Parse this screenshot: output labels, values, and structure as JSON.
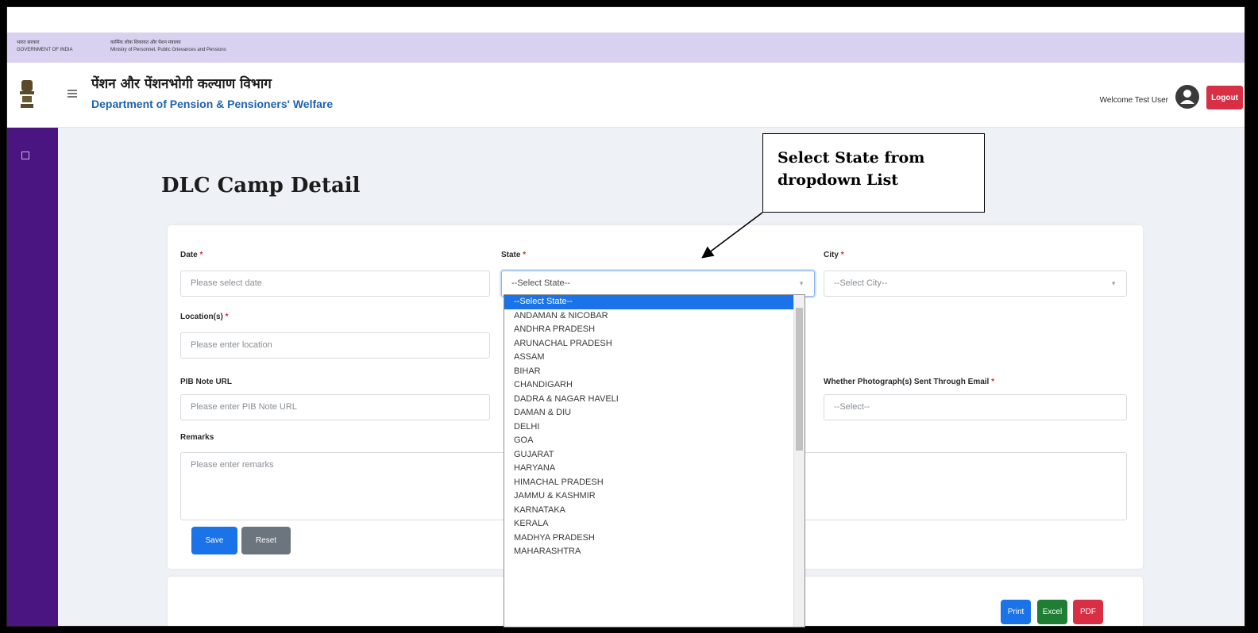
{
  "gov_strip": {
    "left_line1": "भारत सरकार",
    "left_line2": "GOVERNMENT OF INDIA",
    "right_line1": "कार्मिक लोक शिकायत और पेंशन मंत्रालय",
    "right_line2": "Ministry of Personnel, Public Grievances and Pensions"
  },
  "header": {
    "dept_hindi": "पेंशन और पेंशनभोगी कल्याण विभाग",
    "dept_english": "Department of Pension & Pensioners' Welfare",
    "welcome": "Welcome Test User",
    "logout": "Logout"
  },
  "page": {
    "title": "DLC Camp Detail"
  },
  "form": {
    "date_label": "Date",
    "date_placeholder": "Please select date",
    "state_label": "State",
    "state_value": "--Select State--",
    "city_label": "City",
    "city_value": "--Select City--",
    "location_label": "Location(s)",
    "location_placeholder": "Please enter location",
    "pib_label": "PIB Note URL",
    "pib_placeholder": "Please enter PIB Note URL",
    "photo_label": "Whether Photograph(s) Sent Through Email",
    "photo_value": "--Select--",
    "remarks_label": "Remarks",
    "remarks_placeholder": "Please enter remarks",
    "required_mark": "*",
    "save": "Save",
    "reset": "Reset"
  },
  "table_actions": {
    "print": "Print",
    "excel": "Excel",
    "pdf": "PDF"
  },
  "state_options": [
    "--Select State--",
    "ANDAMAN & NICOBAR",
    "ANDHRA PRADESH",
    "ARUNACHAL PRADESH",
    "ASSAM",
    "BIHAR",
    "CHANDIGARH",
    "DADRA & NAGAR HAVELI",
    "DAMAN & DIU",
    "DELHI",
    "GOA",
    "GUJARAT",
    "HARYANA",
    "HIMACHAL PRADESH",
    "JAMMU & KASHMIR",
    "KARNATAKA",
    "KERALA",
    "MADHYA PRADESH",
    "MAHARASHTRA"
  ],
  "callout": {
    "line1": "Select State from",
    "line2": "dropdown List"
  },
  "colors": {
    "sidebar": "#4a1580",
    "strip": "#d8d2f0",
    "primary": "#1a73e8",
    "danger": "#d92f45",
    "success": "#1e7e34"
  }
}
